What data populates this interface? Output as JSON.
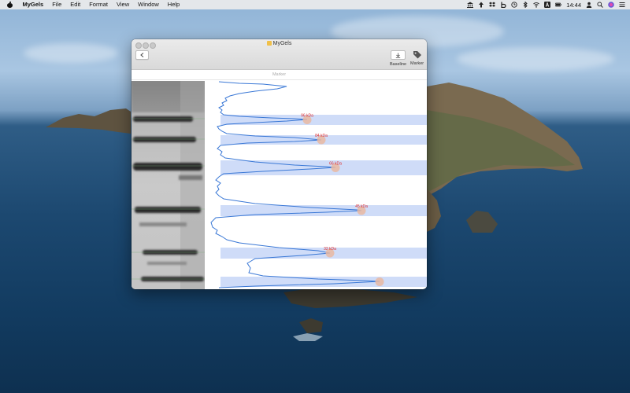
{
  "menubar": {
    "app_name": "MyGels",
    "items": [
      "File",
      "Edit",
      "Format",
      "View",
      "Window",
      "Help"
    ],
    "clock": "14:44"
  },
  "window": {
    "title": "MyGels",
    "toolbar": {
      "baseline_label": "Baseline",
      "marker_label": "Marker"
    },
    "subbar_label": "Marker"
  },
  "chart_data": {
    "type": "line",
    "peaks": [
      {
        "label": "96 kDa",
        "highlighted": true
      },
      {
        "label": "84 kDa",
        "highlighted": true
      },
      {
        "label": "66 kDa",
        "highlighted": true
      },
      {
        "label": "45 kDa",
        "highlighted": true
      },
      {
        "label": "32 kDa",
        "highlighted": true
      },
      {
        "label": "",
        "highlighted": true
      }
    ],
    "colors": {
      "trace": "#3a78d6",
      "band_highlight": "#cfdcf8",
      "peak_marker": "#e9b9a2",
      "peak_label": "#e02c2c"
    }
  }
}
